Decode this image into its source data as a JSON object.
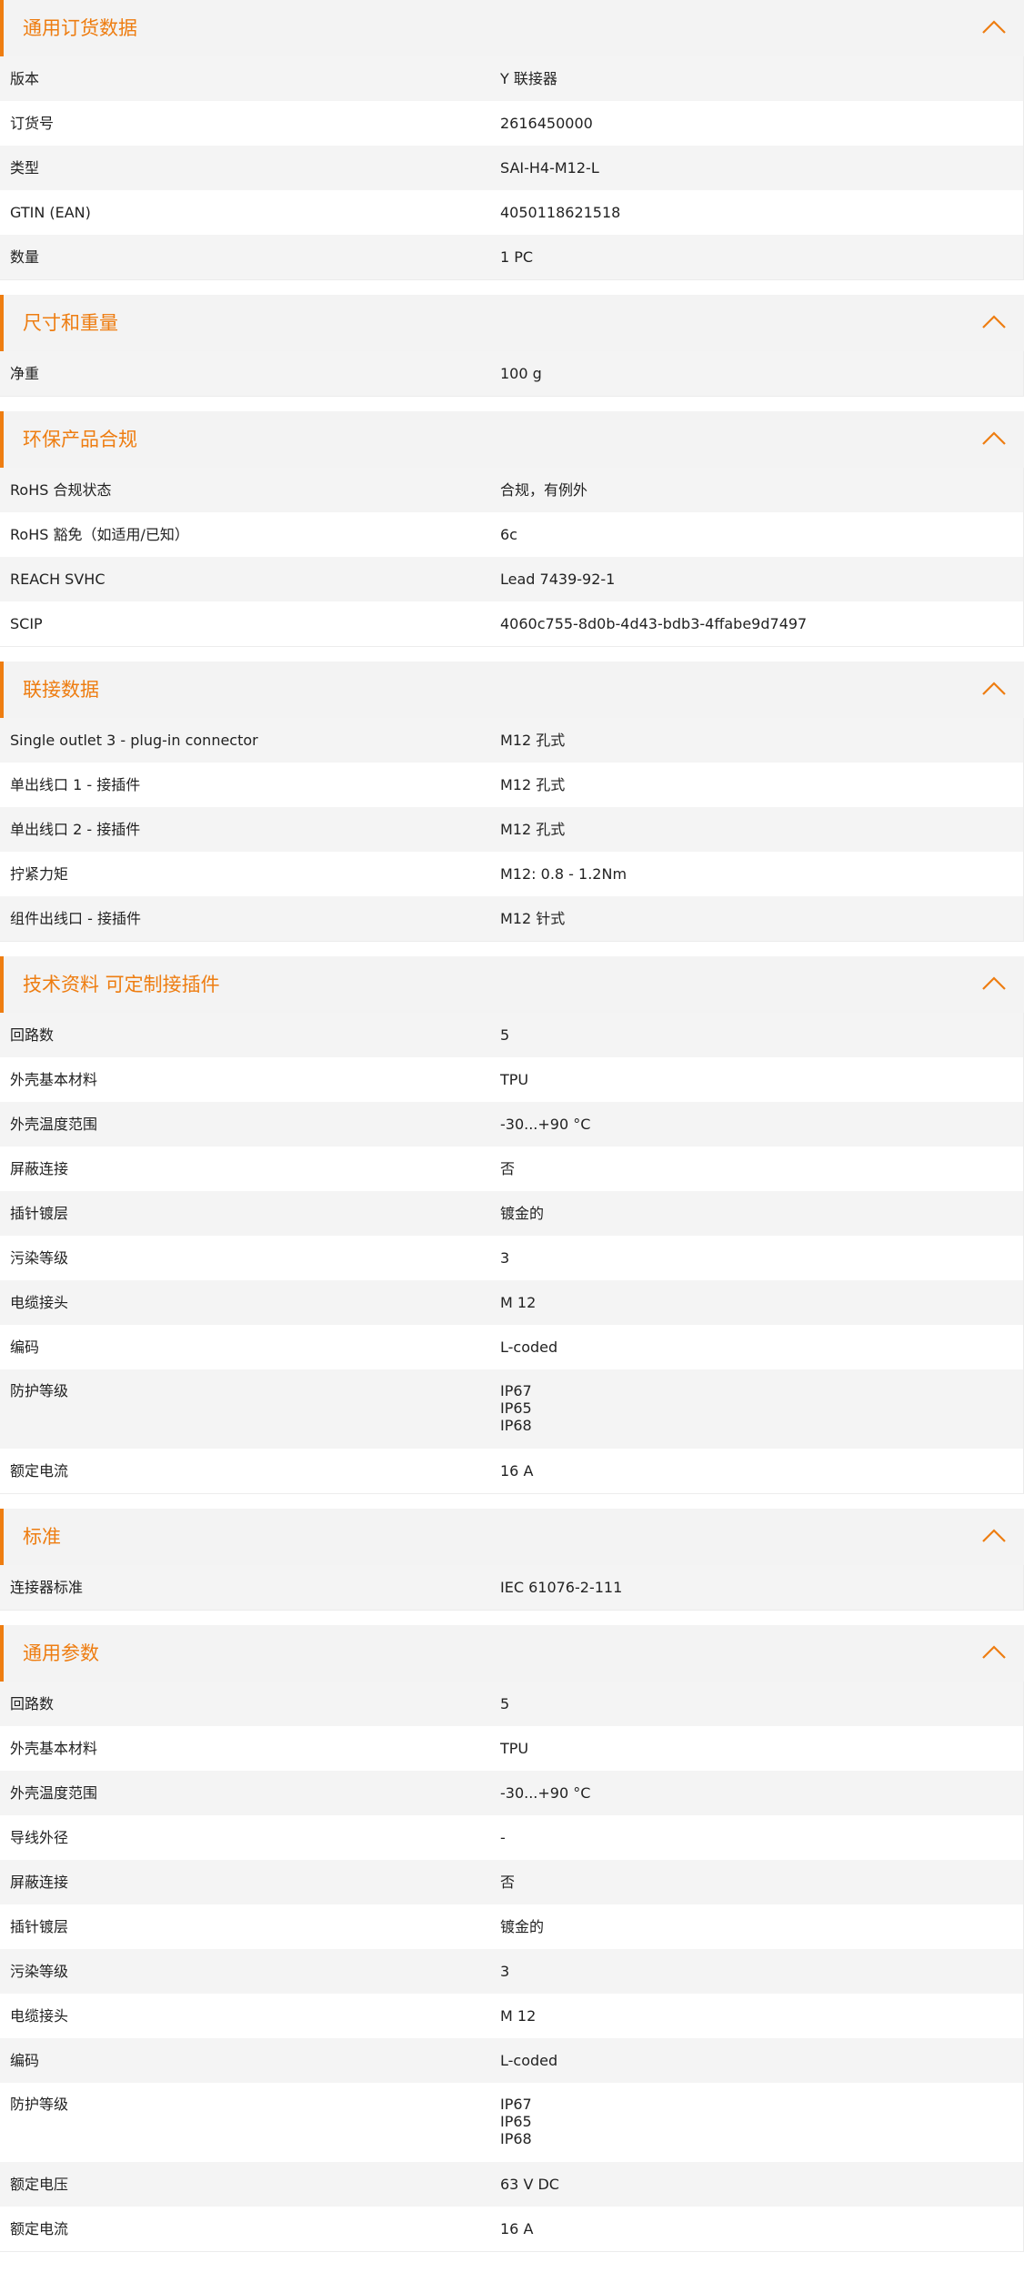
{
  "colors": {
    "accent": "#ee7d11",
    "header_bg": "#f3f3f3",
    "row_alt_bg": "#f4f4f4"
  },
  "sections": [
    {
      "id": "general-order-data",
      "title": "通用订货数据",
      "rows": [
        {
          "label": "版本",
          "value": "Y 联接器"
        },
        {
          "label": "订货号",
          "value": "2616450000"
        },
        {
          "label": "类型",
          "value": "SAI-H4-M12-L"
        },
        {
          "label": "GTIN (EAN)",
          "value": "4050118621518"
        },
        {
          "label": "数量",
          "value": "1  PC"
        }
      ]
    },
    {
      "id": "dimensions-weight",
      "title": "尺寸和重量",
      "rows": [
        {
          "label": "净重",
          "value": "100  g"
        }
      ]
    },
    {
      "id": "environmental-compliance",
      "title": "环保产品合规",
      "rows": [
        {
          "label": "RoHS 合规状态",
          "value": "合规，有例外"
        },
        {
          "label": "RoHS 豁免（如适用/已知）",
          "value": "6c"
        },
        {
          "label": "REACH SVHC",
          "value": "Lead 7439-92-1"
        },
        {
          "label": "SCIP",
          "value": "4060c755-8d0b-4d43-bdb3-4ffabe9d7497"
        }
      ]
    },
    {
      "id": "connection-data",
      "title": "联接数据",
      "rows": [
        {
          "label": "Single outlet 3 - plug-in connector",
          "value": "M12 孔式"
        },
        {
          "label": "单出线口 1 - 接插件",
          "value": "M12 孔式"
        },
        {
          "label": "单出线口 2 - 接插件",
          "value": "M12 孔式"
        },
        {
          "label": "拧紧力矩",
          "value": "M12: 0.8 - 1.2Nm"
        },
        {
          "label": "组件出线口 - 接插件",
          "value": "M12 针式"
        }
      ]
    },
    {
      "id": "technical-customizable",
      "title": "技术资料 可定制接插件",
      "rows": [
        {
          "label": "回路数",
          "value": "5"
        },
        {
          "label": "外壳基本材料",
          "value": "TPU"
        },
        {
          "label": "外壳温度范围",
          "value": "-30...+90 °C"
        },
        {
          "label": "屏蔽连接",
          "value": "否"
        },
        {
          "label": "插针镀层",
          "value": "镀金的"
        },
        {
          "label": "污染等级",
          "value": "3"
        },
        {
          "label": "电缆接头",
          "value": "M 12"
        },
        {
          "label": "编码",
          "value": "L-coded"
        },
        {
          "label": "防护等级",
          "value": "IP67\nIP65\nIP68",
          "multi": true
        },
        {
          "label": "额定电流",
          "value": "16  A"
        }
      ]
    },
    {
      "id": "standards",
      "title": "标准",
      "rows": [
        {
          "label": "连接器标准",
          "value": "IEC 61076-2-111"
        }
      ]
    },
    {
      "id": "general-parameters",
      "title": "通用参数",
      "rows": [
        {
          "label": "回路数",
          "value": "5"
        },
        {
          "label": "外壳基本材料",
          "value": "TPU"
        },
        {
          "label": "外壳温度范围",
          "value": "-30...+90 °C"
        },
        {
          "label": "导线外径",
          "value": "-"
        },
        {
          "label": "屏蔽连接",
          "value": "否"
        },
        {
          "label": "插针镀层",
          "value": "镀金的"
        },
        {
          "label": "污染等级",
          "value": "3"
        },
        {
          "label": "电缆接头",
          "value": "M 12"
        },
        {
          "label": "编码",
          "value": "L-coded"
        },
        {
          "label": "防护等级",
          "value": "IP67\nIP65\nIP68",
          "multi": true
        },
        {
          "label": "额定电压",
          "value": "63 V DC"
        },
        {
          "label": "额定电流",
          "value": "16  A"
        }
      ]
    }
  ]
}
